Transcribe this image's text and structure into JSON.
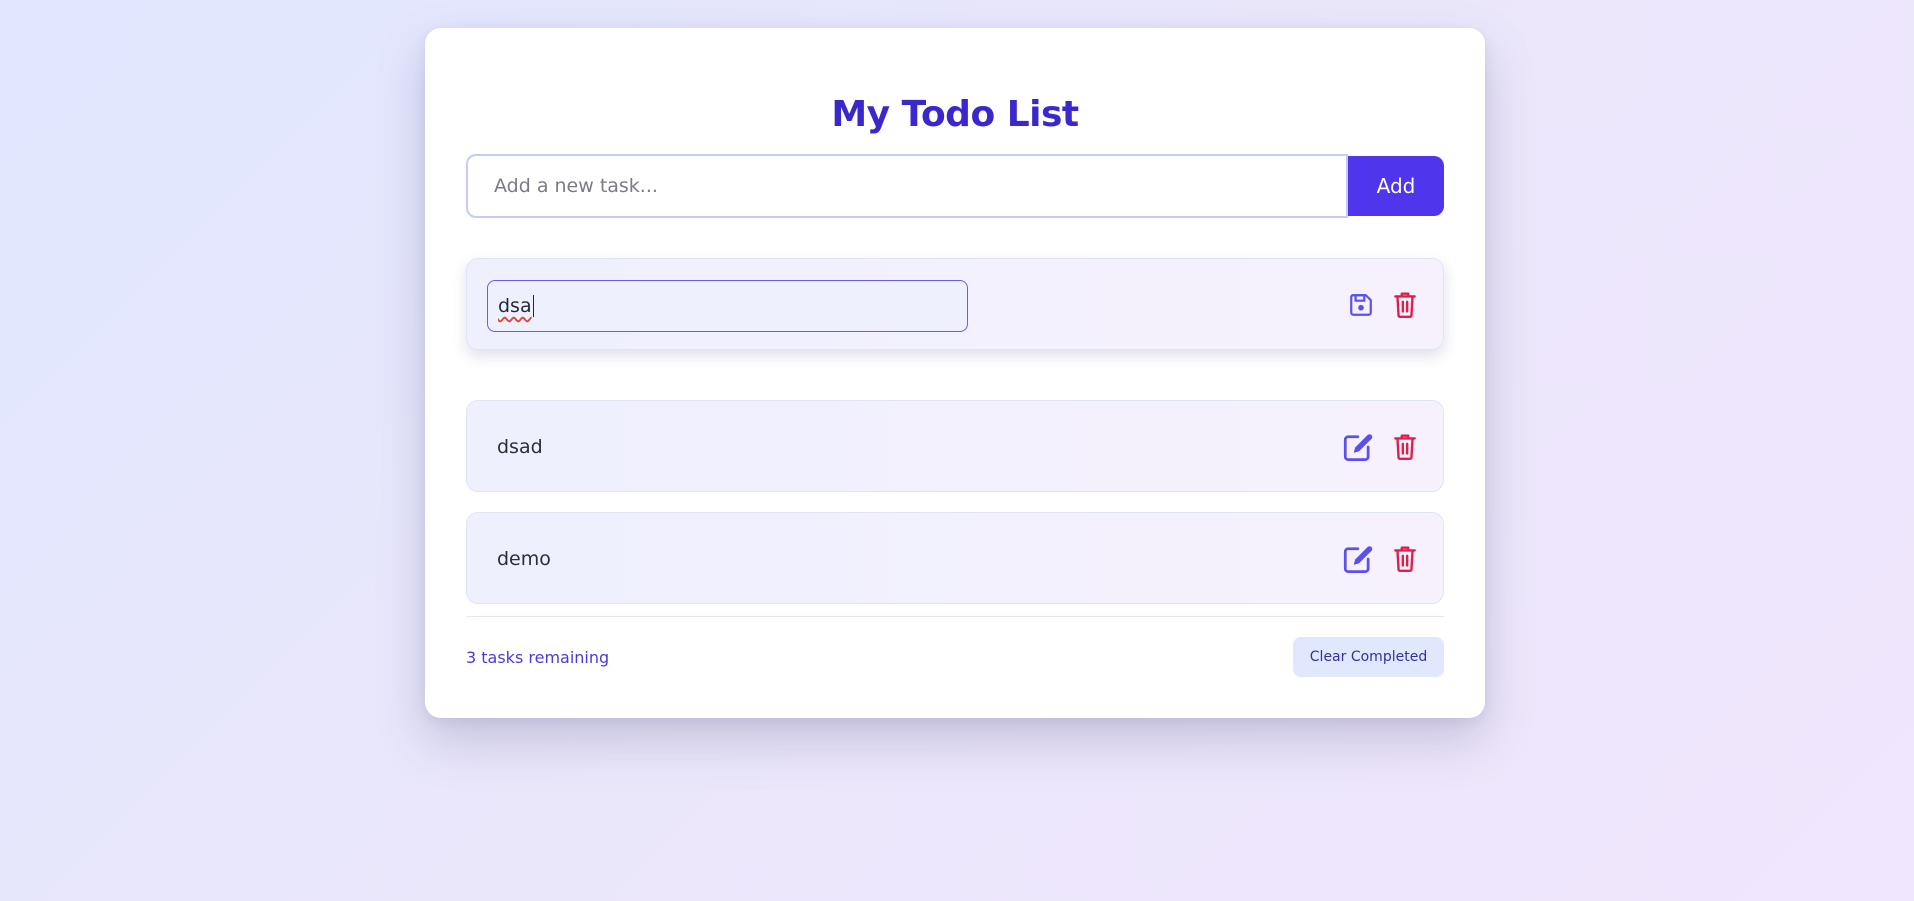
{
  "app": {
    "title": "My Todo List"
  },
  "new_task": {
    "placeholder": "Add a new task...",
    "value": "",
    "add_label": "Add"
  },
  "todos": [
    {
      "text": "dsa",
      "editing": true,
      "actions": [
        "save-icon",
        "trash-icon"
      ]
    },
    {
      "text": "dsad",
      "editing": false,
      "actions": [
        "edit-icon",
        "trash-icon"
      ]
    },
    {
      "text": "demo",
      "editing": false,
      "actions": [
        "edit-icon",
        "trash-icon"
      ]
    }
  ],
  "footer": {
    "remaining_text": "3 tasks remaining",
    "clear_label": "Clear Completed"
  },
  "colors": {
    "accent": "#4f35eb",
    "title": "#3b28cc",
    "edit_icon": "#5b4ff0",
    "delete_icon": "#e11d48"
  }
}
